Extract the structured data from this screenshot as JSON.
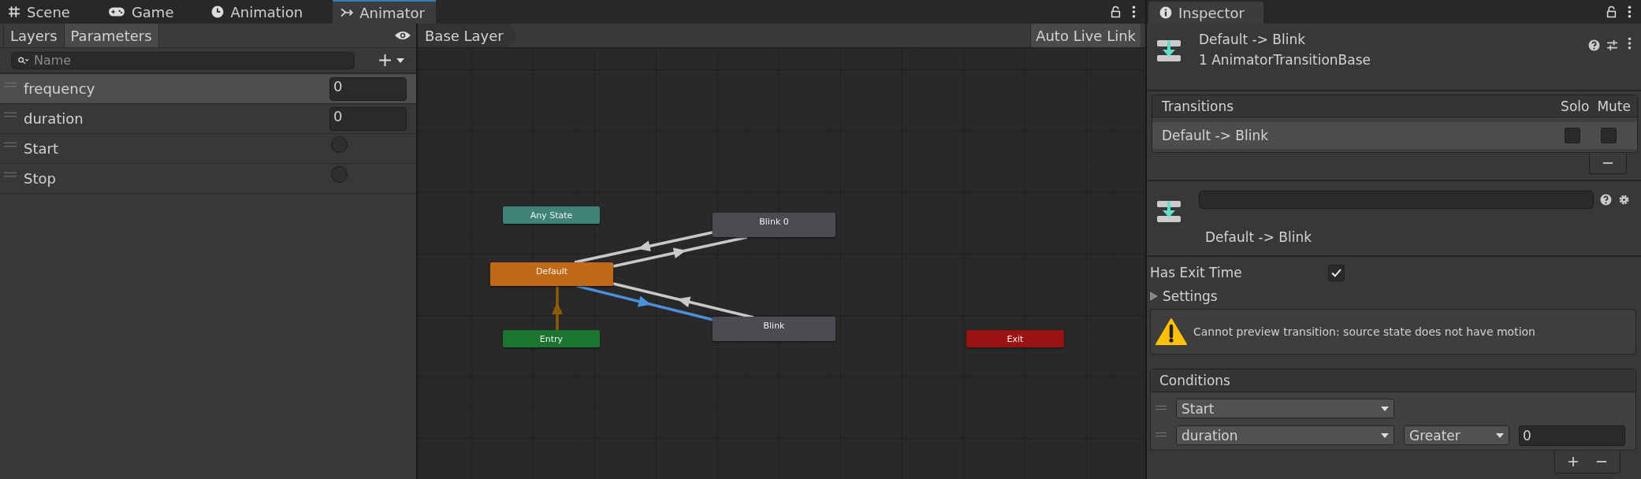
{
  "editor_tabs": [
    {
      "label": "Scene",
      "selected": false
    },
    {
      "label": "Game",
      "selected": false
    },
    {
      "label": "Animation",
      "selected": false
    },
    {
      "label": "Animator",
      "selected": true
    }
  ],
  "animator": {
    "side_tabs": [
      {
        "label": "Layers",
        "selected": false
      },
      {
        "label": "Parameters",
        "selected": true
      }
    ],
    "search": {
      "placeholder": "Name"
    },
    "parameters": [
      {
        "name": "frequency",
        "kind": "float",
        "value": "0",
        "selected": true
      },
      {
        "name": "duration",
        "kind": "float",
        "value": "0",
        "selected": false
      },
      {
        "name": "Start",
        "kind": "trigger",
        "selected": false
      },
      {
        "name": "Stop",
        "kind": "trigger",
        "selected": false
      }
    ],
    "breadcrumb": "Base Layer",
    "live_link_button": "Auto Live Link",
    "states": [
      {
        "name": "Any State",
        "kind": "any"
      },
      {
        "name": "Blink 0",
        "kind": "normal"
      },
      {
        "name": "Default",
        "kind": "default"
      },
      {
        "name": "Entry",
        "kind": "entry"
      },
      {
        "name": "Blink",
        "kind": "normal"
      },
      {
        "name": "Exit",
        "kind": "exit"
      }
    ],
    "transitions": [
      {
        "kind": "normal",
        "selected": false
      },
      {
        "kind": "normal",
        "selected": false
      },
      {
        "kind": "normal",
        "selected": false
      },
      {
        "kind": "normal",
        "selected": true
      },
      {
        "kind": "entry",
        "selected": false
      }
    ]
  },
  "inspector": {
    "tab": "Inspector",
    "header": {
      "title": "Default -> Blink",
      "subtitle": "1 AnimatorTransitionBase"
    },
    "transitions_list": {
      "columns": [
        "Transitions",
        "Solo",
        "Mute"
      ],
      "rows": [
        {
          "name": "Default -> Blink",
          "solo": false,
          "mute": false,
          "selected": true
        }
      ]
    },
    "transition": {
      "label": "Default -> Blink",
      "has_exit_time": {
        "label": "Has Exit Time",
        "checked": true
      },
      "settings": {
        "label": "Settings",
        "expanded": false
      },
      "warning": "Cannot preview transition: source state does not have motion",
      "conditions": {
        "title": "Conditions",
        "rows": [
          {
            "parameter": "Start"
          },
          {
            "parameter": "duration",
            "mode": "Greater",
            "value": "0"
          }
        ]
      }
    }
  }
}
